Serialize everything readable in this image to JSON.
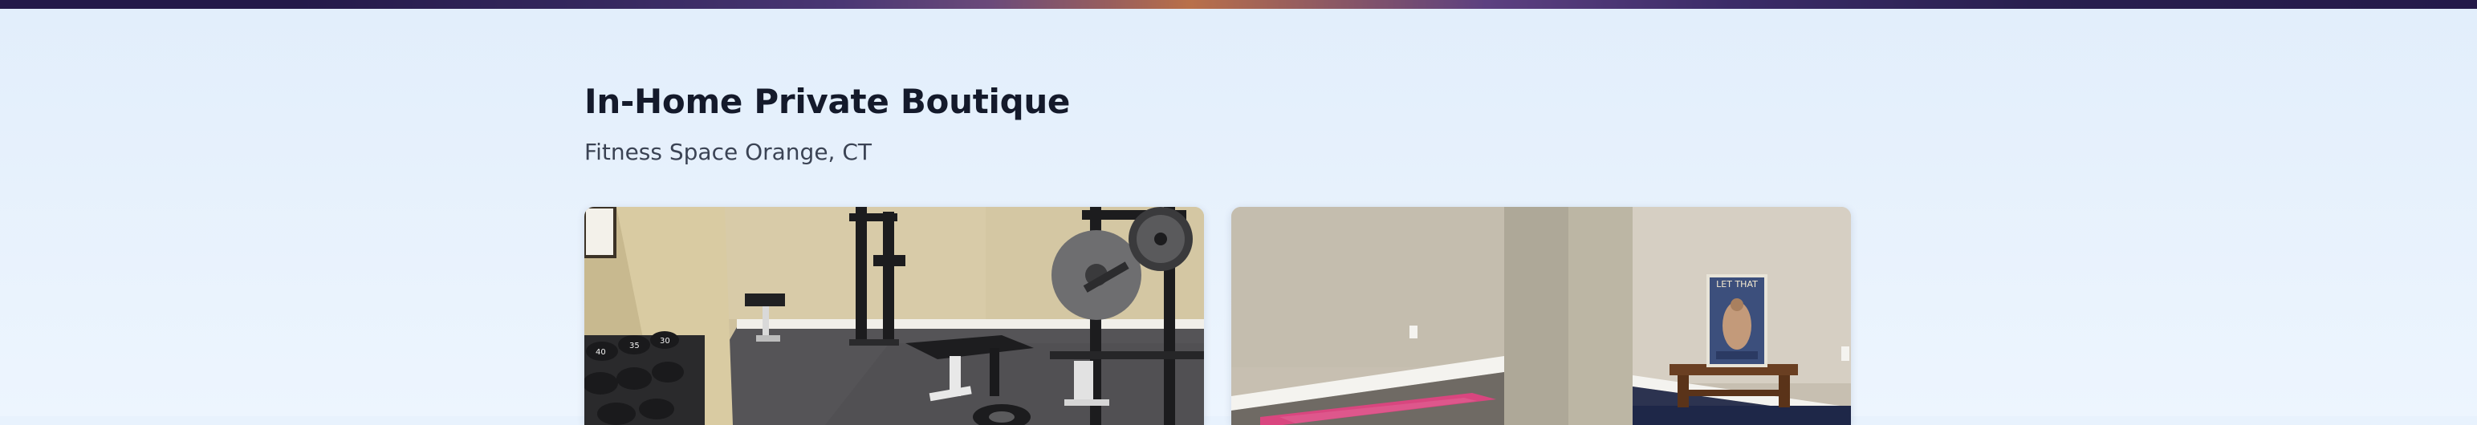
{
  "header": {
    "title": "In-Home Private Boutique",
    "subtitle": "Fitness Space Orange, CT"
  },
  "gallery": {
    "photos": [
      {
        "icon": "gym-equipment-photo"
      },
      {
        "icon": "yoga-room-photo",
        "poster_text": "LET THAT"
      }
    ]
  },
  "colors": {
    "title": "#141a2b",
    "subtitle": "#3b4354",
    "background": "#e8f2fd",
    "topbar": "#241a49",
    "topbar_accent": "#b97049"
  }
}
